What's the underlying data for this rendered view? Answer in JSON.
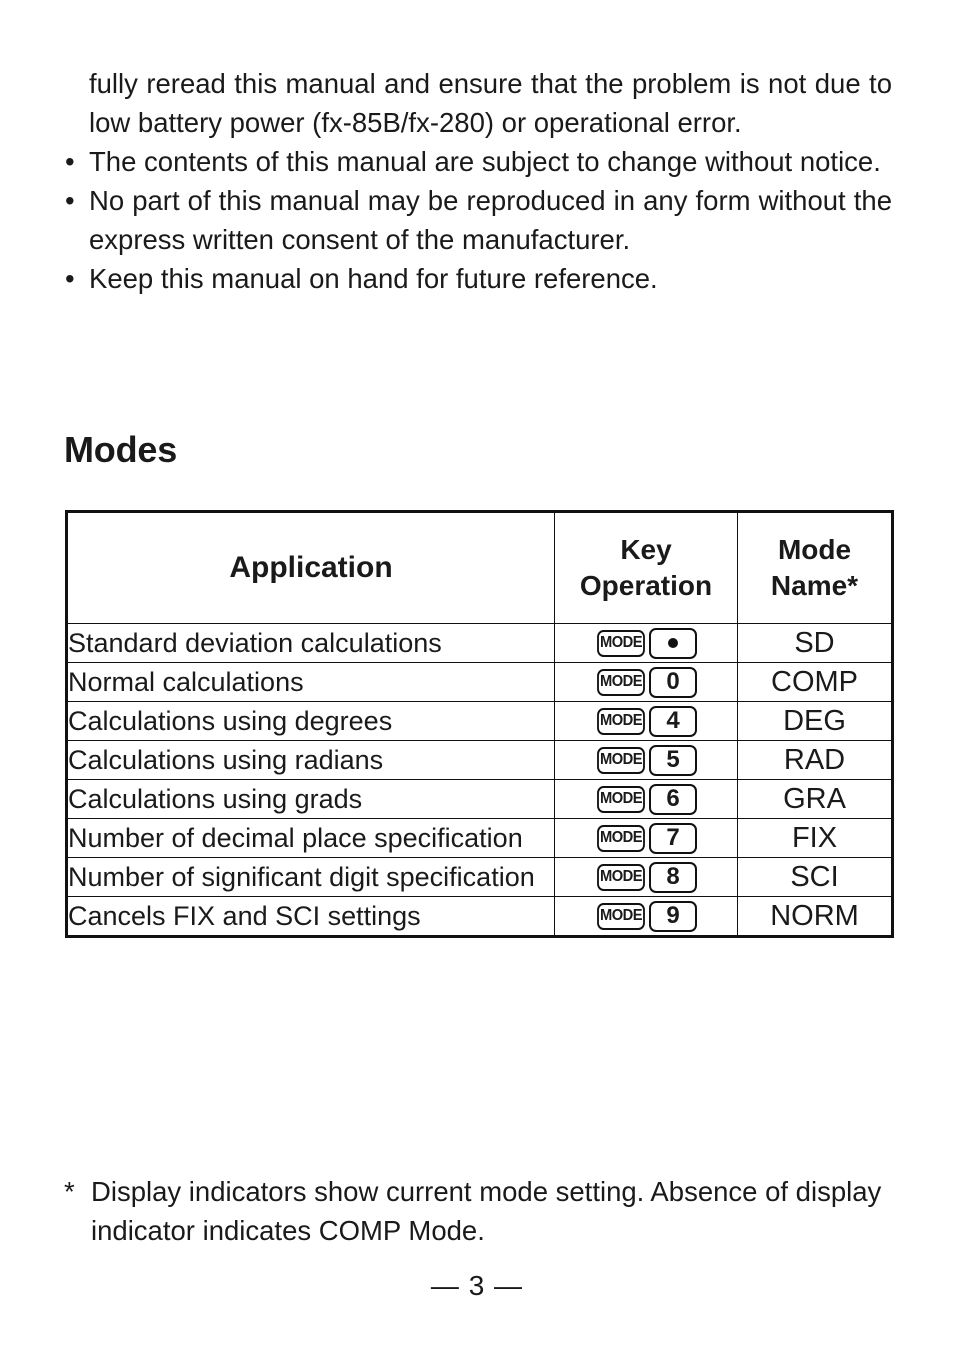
{
  "intro": {
    "paragraphs": [
      {
        "bullet": "",
        "text": "fully reread this manual and ensure that the problem is not due to low battery power (fx-85B/fx-280) or operational error."
      },
      {
        "bullet": "•",
        "text": "The contents of this manual are subject to change without notice."
      },
      {
        "bullet": "•",
        "text": "No part of this manual may be reproduced in any form without the express written consent of the manufacturer."
      },
      {
        "bullet": "•",
        "text": "Keep this manual on hand for future reference."
      }
    ]
  },
  "section": {
    "heading": "Modes"
  },
  "table": {
    "headers": {
      "application": "Application",
      "key_operation_line1": "Key",
      "key_operation_line2": "Operation",
      "mode_name_line1": "Mode",
      "mode_name_line2": "Name*"
    },
    "mode_key_label": "MODE",
    "rows": [
      {
        "application": "Standard deviation calculations",
        "second_key": "●",
        "second_key_type": "dot",
        "mode_name": "SD"
      },
      {
        "application": "Normal calculations",
        "second_key": "0",
        "second_key_type": "num",
        "mode_name": "COMP"
      },
      {
        "application": "Calculations using degrees",
        "second_key": "4",
        "second_key_type": "num",
        "mode_name": "DEG"
      },
      {
        "application": "Calculations using radians",
        "second_key": "5",
        "second_key_type": "num",
        "mode_name": "RAD"
      },
      {
        "application": "Calculations using grads",
        "second_key": "6",
        "second_key_type": "num",
        "mode_name": "GRA"
      },
      {
        "application": "Number of decimal place specification",
        "second_key": "7",
        "second_key_type": "num",
        "mode_name": "FIX"
      },
      {
        "application": "Number of significant digit specification",
        "second_key": "8",
        "second_key_type": "num",
        "mode_name": "SCI"
      },
      {
        "application": "Cancels FIX and SCI settings",
        "second_key": "9",
        "second_key_type": "num",
        "mode_name": "NORM"
      }
    ]
  },
  "footnote": {
    "marker": "*",
    "text": "Display indicators show current mode setting. Absence of display indicator indicates COMP Mode."
  },
  "page_number": "— 3 —",
  "colors": {
    "text": "#1a1a1a",
    "rule": "#111111",
    "background": "#ffffff"
  }
}
